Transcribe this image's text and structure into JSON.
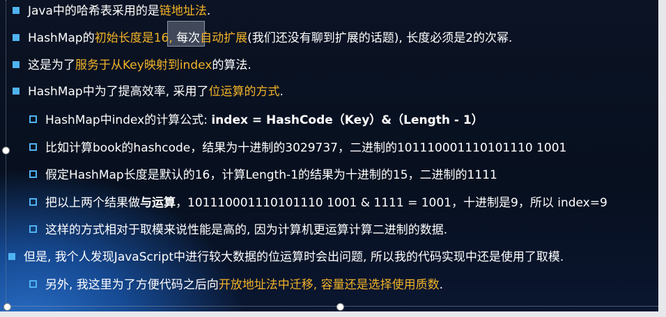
{
  "bullets": [
    {
      "level": 1,
      "parts": [
        {
          "t": "Java中的哈希表采用的是"
        },
        {
          "t": "链地址法",
          "hl": true
        },
        {
          "t": "."
        }
      ]
    },
    {
      "level": 1,
      "parts": [
        {
          "t": "HashMap的"
        },
        {
          "t": "初始长度是16,",
          "hl": true
        },
        {
          "t": " 每次"
        },
        {
          "t": "自动扩展",
          "hl": true
        },
        {
          "t": "(我们还没有聊到扩展的话题), 长度必须是2的次幂."
        }
      ]
    },
    {
      "level": 1,
      "parts": [
        {
          "t": "这是为了"
        },
        {
          "t": "服务于从Key映射到index",
          "hl": true
        },
        {
          "t": "的算法."
        }
      ]
    },
    {
      "level": 1,
      "parts": [
        {
          "t": "HashMap中为了提高效率, 采用了"
        },
        {
          "t": "位运算的方式",
          "hl": true
        },
        {
          "t": "."
        }
      ]
    },
    {
      "level": 2,
      "parts": [
        {
          "t": "HashMap中index的计算公式: "
        },
        {
          "t": "index = HashCode（Key）&（Length - 1）",
          "bold": true
        }
      ]
    },
    {
      "level": 2,
      "parts": [
        {
          "t": "比如计算book的hashcode，结果为十进制的3029737，二进制的101110001110101110 1001"
        }
      ]
    },
    {
      "level": 2,
      "parts": [
        {
          "t": "假定HashMap长度是默认的16，计算Length-1的结果为十进制的15，二进制的1111"
        }
      ]
    },
    {
      "level": 2,
      "parts": [
        {
          "t": "把以上两个结果做"
        },
        {
          "t": "与运算",
          "bold": true
        },
        {
          "t": "，101110001110101110 1001 & 1111 = 1001，十进制是9，所以 index=9"
        }
      ]
    },
    {
      "level": 2,
      "parts": [
        {
          "t": "这样的方式相对于取模来说性能是高的, 因为计算机更运算计算二进制的数据."
        }
      ]
    },
    {
      "level": 1,
      "parts": [
        {
          "t": "但是, 我个人发现JavaScript中进行较大数据的位运算时会出问题, 所以我的代码实现中还是使用了取模."
        }
      ]
    },
    {
      "level": 2,
      "parts": [
        {
          "t": "另外, 我这里为了方便代码之后向"
        },
        {
          "t": "开放地址法中迁移,",
          "hl": true
        },
        {
          "t": " "
        },
        {
          "t": "容量还是选择使用质数",
          "hl": true
        },
        {
          "t": "."
        }
      ]
    }
  ],
  "colors": {
    "highlight": "#f2b328",
    "bullet": "#4fb3f2"
  }
}
